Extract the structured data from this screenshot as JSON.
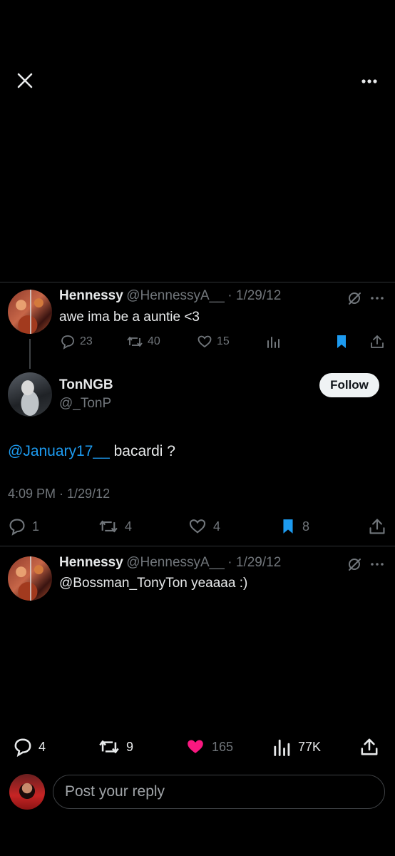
{
  "header": {
    "close_icon": "close-icon",
    "more_icon": "more-horizontal-icon"
  },
  "tweet_1": {
    "name": "Hennessy",
    "handle": "@HennessyA__",
    "date": "· 1/29/12",
    "text": "awe ima be a auntie <3",
    "replies": "23",
    "retweets": "40",
    "likes": "15"
  },
  "main_tweet": {
    "name": "TonNGB",
    "handle": "@_TonP",
    "follow_label": "Follow",
    "mention": "@January17__",
    "text": " bacardi ?",
    "timestamp": "4:09 PM · 1/29/12",
    "replies": "1",
    "retweets": "4",
    "likes": "4",
    "bookmarks": "8"
  },
  "tweet_3": {
    "name": "Hennessy",
    "handle": "@HennessyA__",
    "date": "· 1/29/12",
    "text": "@Bossman_TonyTon yeaaaa :)"
  },
  "bottom_bar": {
    "replies": "4",
    "retweets": "9",
    "likes": "165",
    "views": "77K"
  },
  "reply": {
    "placeholder": "Post your reply"
  },
  "colors": {
    "background": "#000000",
    "accent_blue": "#1d9bf0",
    "like_pink": "#f91880",
    "muted_text": "#71767b"
  }
}
